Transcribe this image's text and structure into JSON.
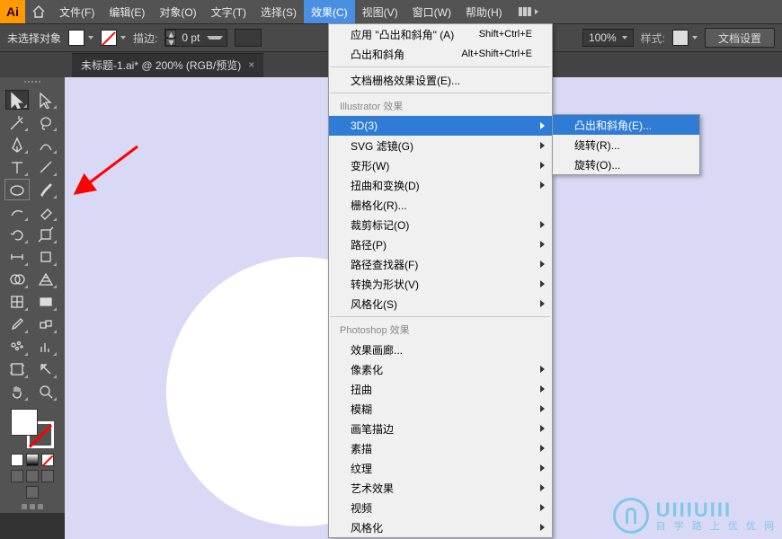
{
  "menubar": {
    "items": [
      {
        "label": "文件(F)"
      },
      {
        "label": "编辑(E)"
      },
      {
        "label": "对象(O)"
      },
      {
        "label": "文字(T)"
      },
      {
        "label": "选择(S)"
      },
      {
        "label": "效果(C)",
        "open": true
      },
      {
        "label": "视图(V)"
      },
      {
        "label": "窗口(W)"
      },
      {
        "label": "帮助(H)"
      }
    ]
  },
  "controlbar": {
    "no_selection": "未选择对象",
    "stroke_label": "描边:",
    "stroke_value": "0 pt",
    "zoom": "100%",
    "style_label": "样式:",
    "doc_setup": "文档设置"
  },
  "tab": {
    "title": "未标题-1.ai* @ 200% (RGB/预览)",
    "close": "×"
  },
  "dropdown": {
    "section1": [
      {
        "label": "应用 \"凸出和斜角\" (A)",
        "shortcut": "Shift+Ctrl+E"
      },
      {
        "label": "凸出和斜角",
        "shortcut": "Alt+Shift+Ctrl+E"
      }
    ],
    "doc_grid": "文档栅格效果设置(E)...",
    "header_illustrator": "Illustrator 效果",
    "section2": [
      {
        "label": "3D(3)",
        "hover": true
      },
      {
        "label": "SVG 滤镜(G)"
      },
      {
        "label": "变形(W)"
      },
      {
        "label": "扭曲和变换(D)"
      },
      {
        "label": "栅格化(R)..."
      },
      {
        "label": "裁剪标记(O)"
      },
      {
        "label": "路径(P)"
      },
      {
        "label": "路径查找器(F)"
      },
      {
        "label": "转换为形状(V)"
      },
      {
        "label": "风格化(S)"
      }
    ],
    "header_photoshop": "Photoshop 效果",
    "section3": [
      {
        "label": "效果画廊..."
      },
      {
        "label": "像素化"
      },
      {
        "label": "扭曲"
      },
      {
        "label": "模糊"
      },
      {
        "label": "画笔描边"
      },
      {
        "label": "素描"
      },
      {
        "label": "纹理"
      },
      {
        "label": "艺术效果"
      },
      {
        "label": "视频"
      },
      {
        "label": "风格化"
      }
    ],
    "submenu": [
      {
        "label": "凸出和斜角(E)...",
        "hover": true
      },
      {
        "label": "绕转(R)..."
      },
      {
        "label": "旋转(O)..."
      }
    ]
  },
  "watermark": {
    "letters": "UIIIUIII",
    "sub": "自 学 路 上 优 优 网"
  }
}
